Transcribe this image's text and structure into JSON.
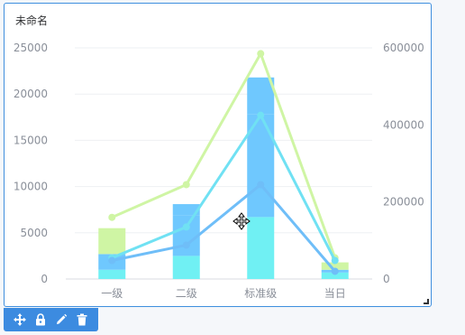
{
  "widget": {
    "title": "未命名"
  },
  "toolbar": {
    "icons": [
      "move-icon",
      "lock-icon",
      "edit-icon",
      "delete-icon"
    ],
    "color": "#3c8be0"
  },
  "colors": {
    "bar_base": "#70f0f3",
    "bar_mid": "#cff5a4",
    "bar_top": "#6fc8fe",
    "line_light_green": "#cff5a4",
    "line_cyan": "#70e1f3",
    "line_blue": "#6fbef8",
    "axis_text": "#8a8f99",
    "border_accent": "#3f8fde"
  },
  "chart_data": {
    "type": "bar",
    "categories": [
      "一级",
      "二级",
      "标准级",
      "当日"
    ],
    "stacked_bars": [
      {
        "name": "",
        "values": [
          1000,
          2500,
          6700,
          700
        ],
        "color": "#70f0f3"
      },
      {
        "name": "",
        "values": [
          1700,
          4400,
          11100,
          300
        ],
        "color": "#6fc8fe"
      },
      {
        "name": "",
        "values": [
          2800,
          0,
          0,
          800
        ],
        "color": "#cff5a4"
      },
      {
        "name": "",
        "values": [
          0,
          1200,
          4000,
          0
        ],
        "color": "#6fc8fe"
      }
    ],
    "line_series": [
      {
        "name": "",
        "axis": "right",
        "values": [
          160000,
          245000,
          585000,
          55000
        ],
        "color": "#cff5a4"
      },
      {
        "name": "",
        "axis": "right",
        "values": [
          55000,
          135000,
          425000,
          48000
        ],
        "color": "#70e1f3"
      },
      {
        "name": "",
        "axis": "right",
        "values": [
          48000,
          88000,
          245000,
          20000
        ],
        "color": "#6fbef8"
      }
    ],
    "y_left": {
      "min": 0,
      "max": 25000,
      "ticks": [
        "0",
        "5000",
        "10000",
        "15000",
        "20000",
        "25000"
      ]
    },
    "y_right": {
      "min": 0,
      "max": 600000,
      "ticks": [
        "0",
        "200000",
        "400000",
        "600000"
      ]
    },
    "grid": true,
    "legend": "none"
  }
}
